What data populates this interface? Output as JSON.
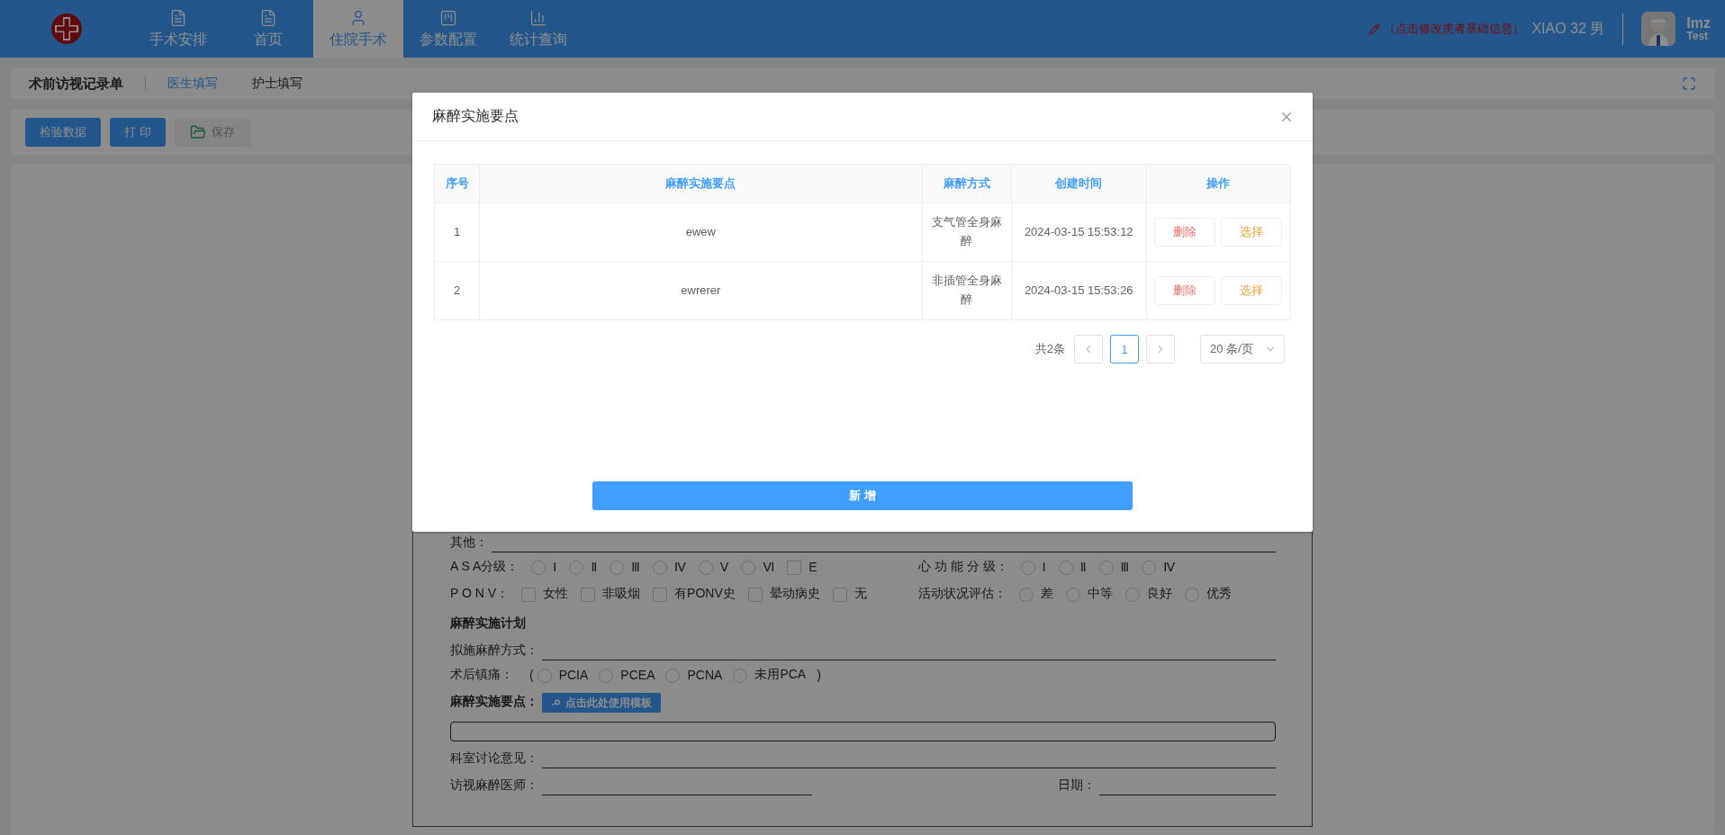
{
  "header": {
    "nav": [
      {
        "label": "手术安排",
        "selected": false
      },
      {
        "label": "首页",
        "selected": false
      },
      {
        "label": "住院手术",
        "selected": true
      },
      {
        "label": "参数配置",
        "selected": false
      },
      {
        "label": "统计查询",
        "selected": false
      }
    ],
    "patient_edit": "（点击修改患者基础信息）",
    "patient": "XIAO 32 男",
    "user": {
      "name": "lmz",
      "role": "Test"
    }
  },
  "subbar": {
    "title": "术前访视记录单",
    "tabs": [
      {
        "label": "医生填写",
        "selected": true
      },
      {
        "label": "护士填写",
        "selected": false
      }
    ]
  },
  "toolbar": {
    "buttons": [
      {
        "label": "检验数据",
        "kind": "primary"
      },
      {
        "label": "打 印",
        "kind": "primary"
      },
      {
        "label": "保存",
        "kind": "save"
      }
    ]
  },
  "form": {
    "rows": [
      {
        "kind": "line",
        "label": "其他："
      },
      {
        "kind": "options",
        "groups": [
          {
            "label": "A S A分级：",
            "options": [
              {
                "kind": "radio",
                "label": "Ⅰ",
                "checked": false
              },
              {
                "kind": "radio",
                "label": "Ⅱ",
                "checked": false
              },
              {
                "kind": "radio",
                "label": "Ⅲ",
                "checked": false
              },
              {
                "kind": "radio",
                "label": "Ⅳ",
                "checked": false
              },
              {
                "kind": "radio",
                "label": "Ⅴ",
                "checked": false
              },
              {
                "kind": "radio",
                "label": "Ⅵ",
                "checked": false
              },
              {
                "kind": "checkbox",
                "label": "E",
                "checked": false
              }
            ]
          },
          {
            "label": "心 功 能 分 级：",
            "options": [
              {
                "kind": "radio",
                "label": "Ⅰ",
                "checked": false
              },
              {
                "kind": "radio",
                "label": "Ⅱ",
                "checked": false
              },
              {
                "kind": "radio",
                "label": "Ⅲ",
                "checked": false
              },
              {
                "kind": "radio",
                "label": "Ⅳ",
                "checked": false
              }
            ]
          }
        ]
      },
      {
        "kind": "options",
        "groups": [
          {
            "label": "P O N V：",
            "options": [
              {
                "kind": "checkbox",
                "label": "女性",
                "checked": false
              },
              {
                "kind": "checkbox",
                "label": "非吸烟",
                "checked": false
              },
              {
                "kind": "checkbox",
                "label": "有PONV史",
                "checked": false
              },
              {
                "kind": "checkbox",
                "label": "晕动病史",
                "checked": false
              },
              {
                "kind": "checkbox",
                "label": "无",
                "checked": false
              }
            ]
          },
          {
            "label": "活动状况评估：",
            "options": [
              {
                "kind": "radio",
                "label": "差",
                "checked": false
              },
              {
                "kind": "radio",
                "label": "中等",
                "checked": false
              },
              {
                "kind": "radio",
                "label": "良好",
                "checked": false
              },
              {
                "kind": "radio",
                "label": "优秀",
                "checked": false
              }
            ]
          }
        ]
      },
      {
        "kind": "heading",
        "label": "麻醉实施计划"
      },
      {
        "kind": "line",
        "label": "拟施麻醉方式："
      },
      {
        "kind": "paren",
        "label": "术后镇痛：",
        "open": "(",
        "close": ")",
        "options": [
          {
            "kind": "radio",
            "label": "PCIA",
            "checked": false
          },
          {
            "kind": "radio",
            "label": "PCEA",
            "checked": false
          },
          {
            "kind": "radio",
            "label": "PCNA",
            "checked": false
          },
          {
            "kind": "radio",
            "label": "未用PCA",
            "checked": false
          }
        ]
      },
      {
        "kind": "template",
        "label": "麻醉实施要点：",
        "button": "点击此处使用模板"
      },
      {
        "kind": "textbox"
      },
      {
        "kind": "line",
        "label": "科室讨论意见："
      },
      {
        "kind": "sign",
        "label": "访视麻醉医师：",
        "date_label": "日期："
      }
    ]
  },
  "dialog": {
    "title": "麻醉实施要点",
    "table": {
      "columns": [
        "序号",
        "麻醉实施要点",
        "麻醉方式",
        "创建时间",
        "操作"
      ],
      "rows": [
        {
          "index": "1",
          "point": "ewew",
          "method": "支气管全身麻醉",
          "created": "2024-03-15 15:53:12",
          "actions": [
            "删除",
            "选择"
          ]
        },
        {
          "index": "2",
          "point": "ewrerer",
          "method": "非插管全身麻醉",
          "created": "2024-03-15 15:53:26",
          "actions": [
            "删除",
            "选择"
          ]
        }
      ]
    },
    "pagination": {
      "total": "共2条",
      "pages": [
        {
          "label": "1",
          "selected": true
        }
      ],
      "page_size": "20 条/页"
    },
    "add_button": "新 增"
  }
}
